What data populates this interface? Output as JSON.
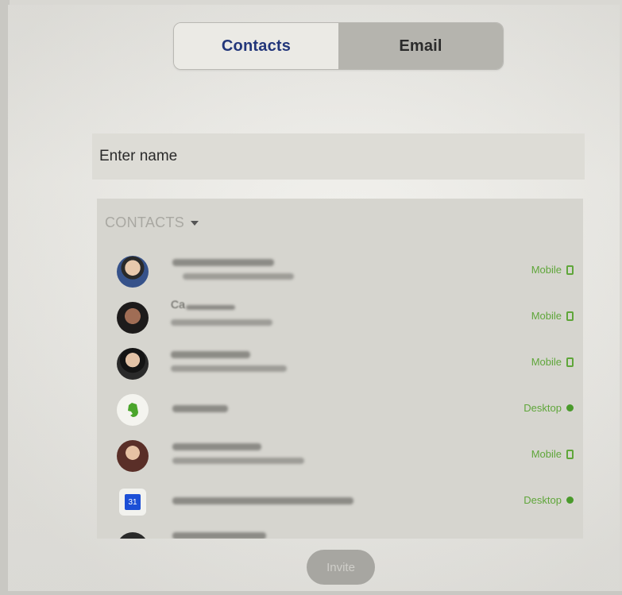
{
  "tabs": [
    {
      "label": "Contacts",
      "active": true
    },
    {
      "label": "Email",
      "active": false
    }
  ],
  "search": {
    "placeholder": "Enter name"
  },
  "contacts_header": "CONTACTS",
  "contacts": [
    {
      "name": "",
      "status": "Mobile",
      "status_icon": "mobile-icon"
    },
    {
      "name": "Ca",
      "status": "Mobile",
      "status_icon": "mobile-icon"
    },
    {
      "name": "",
      "status": "Mobile",
      "status_icon": "mobile-icon"
    },
    {
      "name": "",
      "status": "Desktop",
      "status_icon": "online-dot-icon"
    },
    {
      "name": "",
      "status": "Mobile",
      "status_icon": "mobile-icon"
    },
    {
      "name": "",
      "status": "Desktop",
      "status_icon": "online-dot-icon"
    }
  ],
  "invite_label": "Invite",
  "colors": {
    "accent": "#22367a",
    "status_green": "#5fa63a"
  }
}
